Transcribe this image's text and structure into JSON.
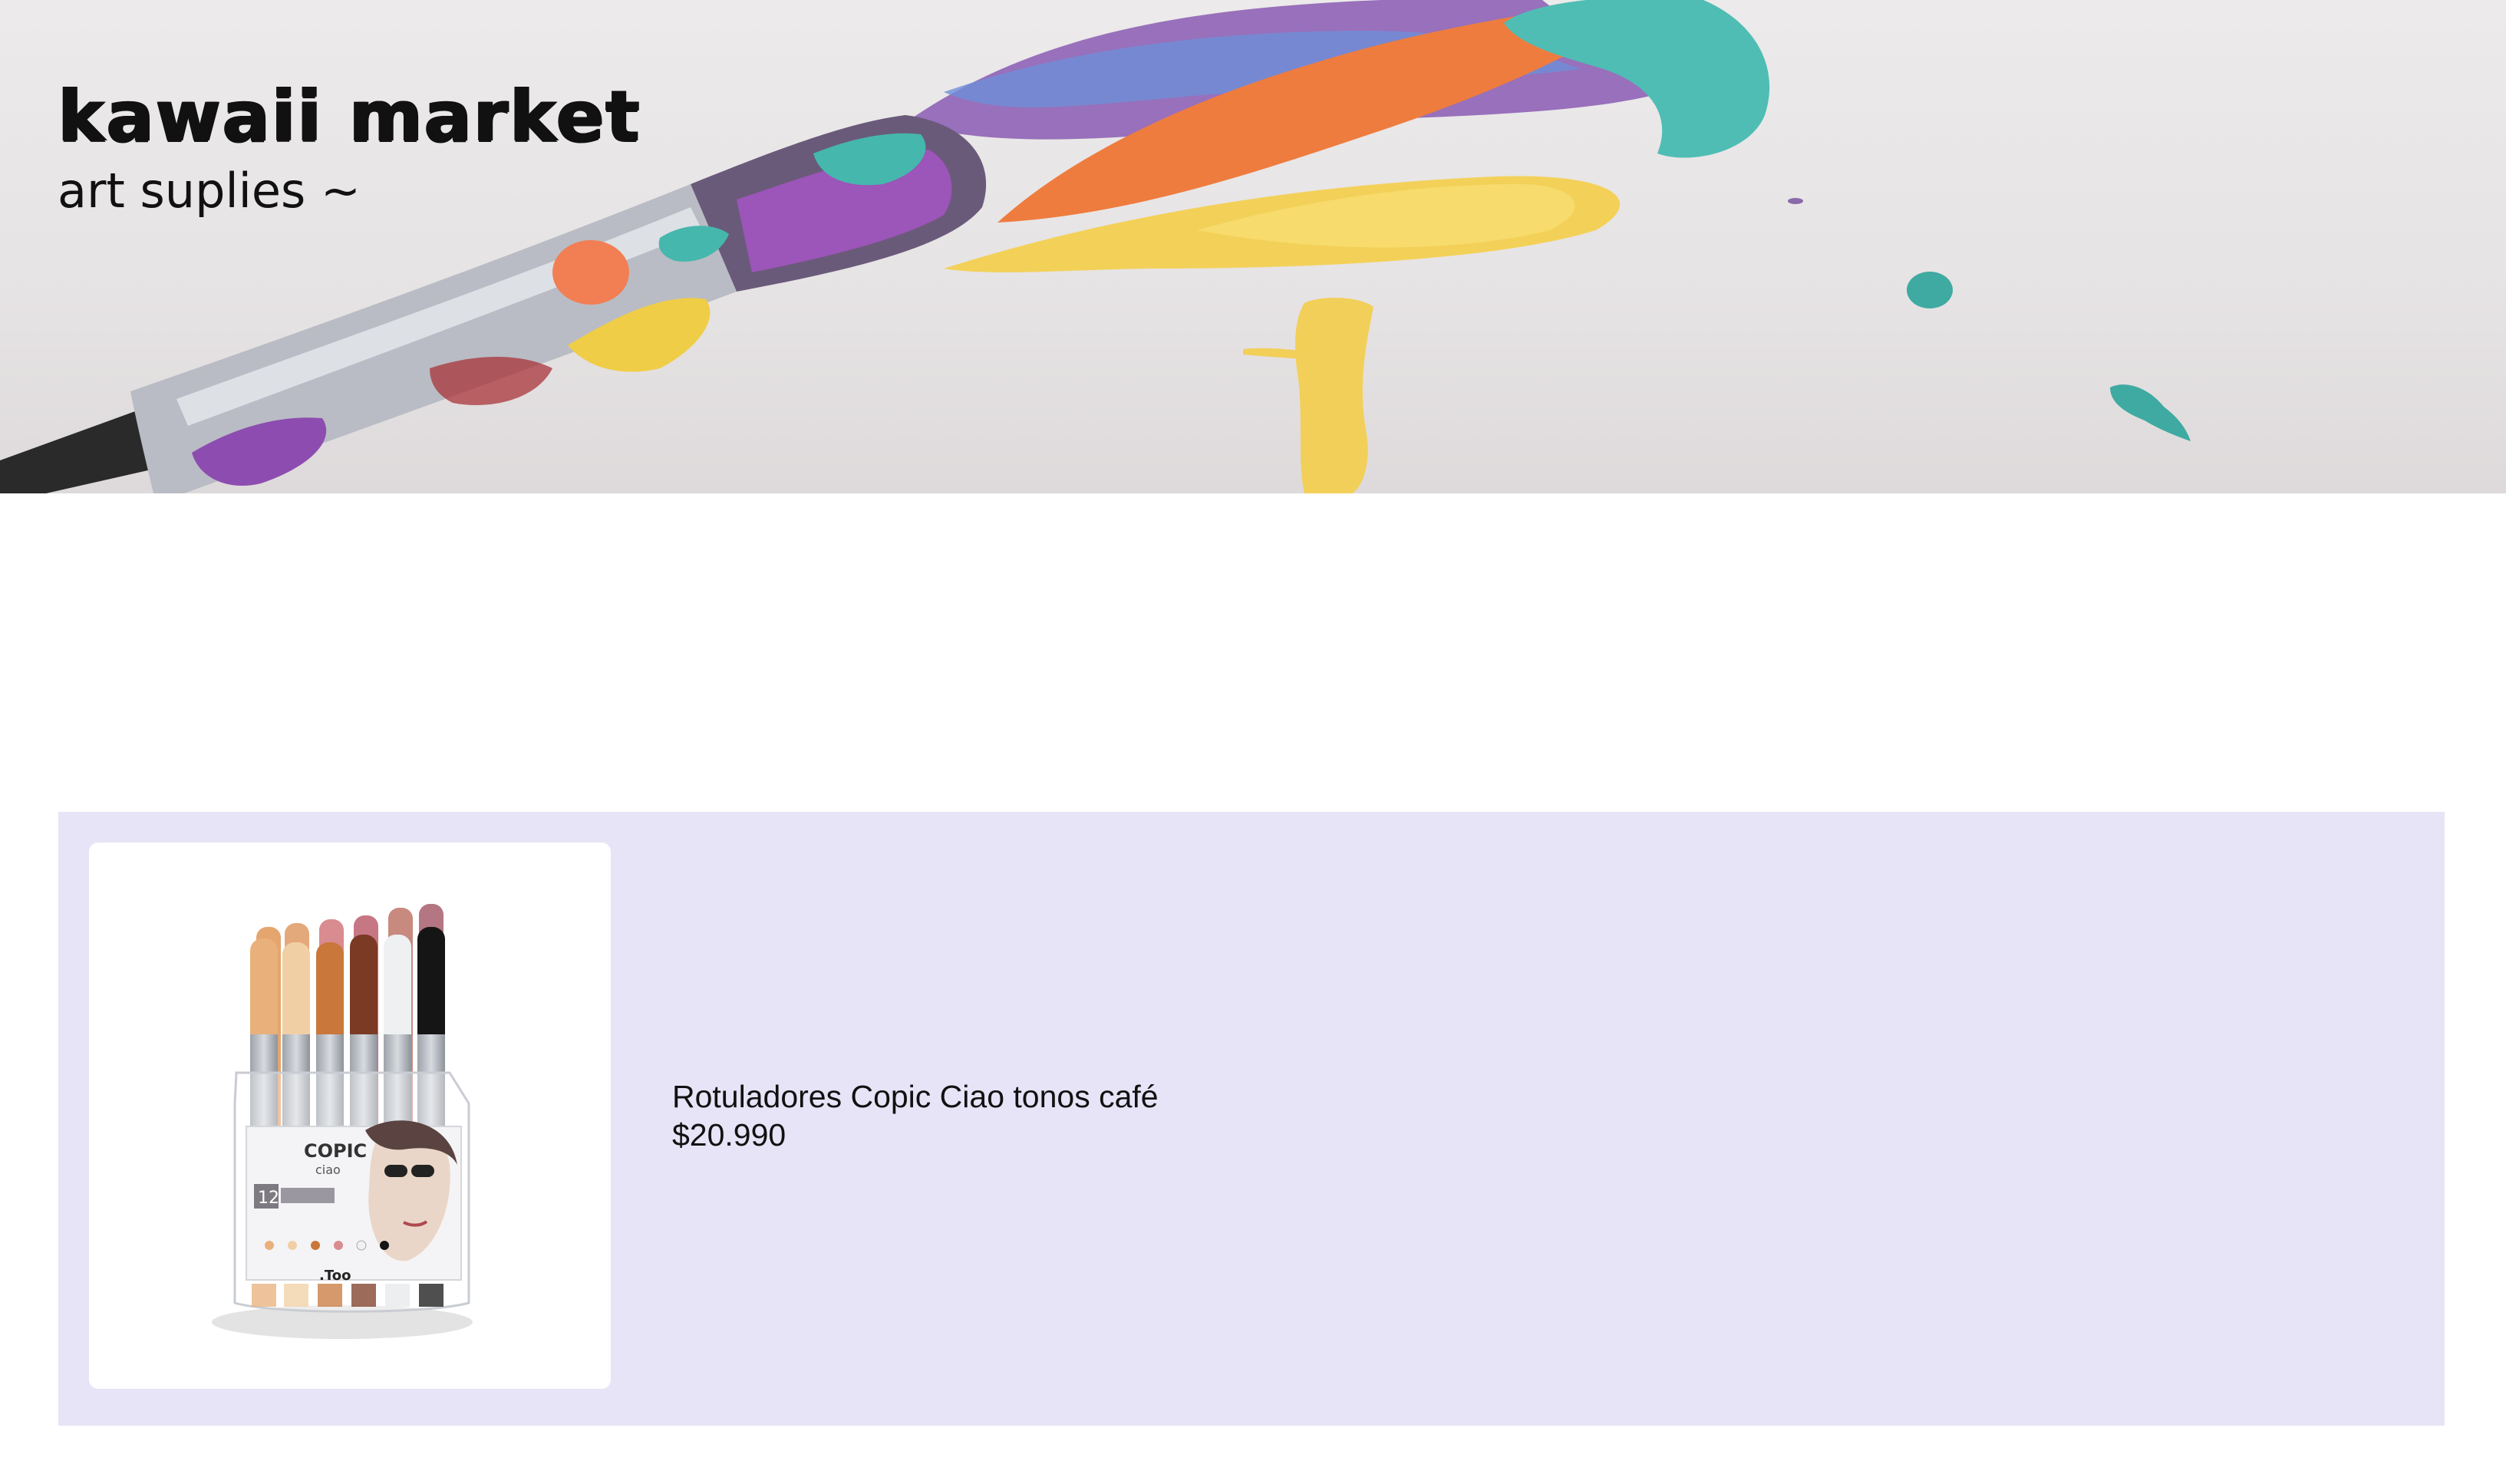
{
  "header": {
    "title": "kawaii market",
    "subtitle": "art suplies ~",
    "image_icon": "paintbrush-image"
  },
  "products": [
    {
      "name": "Rotuladores Copic Ciao tonos café",
      "price": "$20.990",
      "image_icon": "copic-marker-set-image",
      "package_brand": "COPIC",
      "package_line": "ciao",
      "package_count": "12",
      "package_maker": ".Too"
    }
  ],
  "colors": {
    "page_bg": "#ffffff",
    "product_section_bg": "#e6e4f6",
    "text": "#111111"
  }
}
